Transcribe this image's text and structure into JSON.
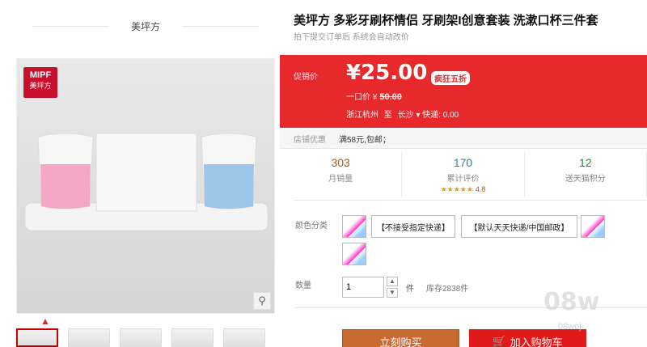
{
  "store": {
    "name": "美坪方"
  },
  "brand_badge": {
    "line1": "MIPF",
    "line2": "美坪方"
  },
  "product": {
    "title": "美坪方 多彩牙刷杯情侣 牙刷架I创意套装 洗漱口杯三件套",
    "subtitle": "拍下提交订单后 系统会自动改价"
  },
  "price": {
    "label": "促销价",
    "current": "¥25.00",
    "tag": "疯狂五折",
    "orig_label": "一口价 ¥",
    "orig_value": "50.00",
    "ship_from": "浙江杭州",
    "ship_to_word": "至",
    "ship_to": "长沙",
    "ship_fee": "快递: 0.00"
  },
  "promo": {
    "label": "店铺优惠",
    "value": "满58元,包邮；"
  },
  "stats": [
    {
      "num": "303",
      "cap": "月销量"
    },
    {
      "num": "170",
      "cap": "累计评价",
      "stars": "★★★★★",
      "rating": "4.8"
    },
    {
      "num": "12",
      "cap": "送天猫积分"
    }
  ],
  "options": {
    "label": "颜色分类",
    "text_opts": [
      "【不接受指定快递】",
      "【默认天天快递/中国邮政】"
    ]
  },
  "quantity": {
    "label": "数量",
    "value": "1",
    "unit": "件",
    "stock": "库存2838件"
  },
  "buttons": {
    "buy": "立刻购买",
    "cart": "加入购物车"
  },
  "watermark": {
    "main": "08w",
    "sub": "08woj"
  }
}
